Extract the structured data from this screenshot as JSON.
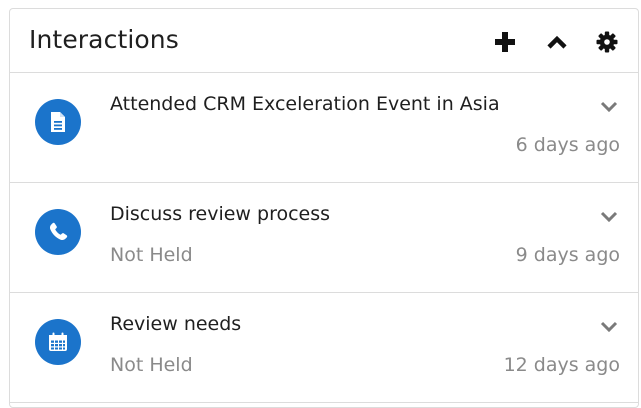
{
  "panel": {
    "title": "Interactions",
    "actions": [
      {
        "name": "add",
        "icon": "plus-icon"
      },
      {
        "name": "collapse",
        "icon": "chevron-up-icon"
      },
      {
        "name": "settings",
        "icon": "gear-icon"
      }
    ]
  },
  "items": [
    {
      "icon": "document-icon",
      "name": "Attended CRM Exceleration Event in Asia",
      "status": "",
      "time": "6 days ago"
    },
    {
      "icon": "phone-icon",
      "name": "Discuss review process",
      "status": "Not Held",
      "time": "9 days ago"
    },
    {
      "icon": "calendar-icon",
      "name": "Review needs",
      "status": "Not Held",
      "time": "12 days ago"
    }
  ],
  "colors": {
    "avatar_bg": "#1b74cb",
    "text": "#1f1f1f",
    "muted": "#8a8a8a",
    "border": "#dcdcdc"
  }
}
